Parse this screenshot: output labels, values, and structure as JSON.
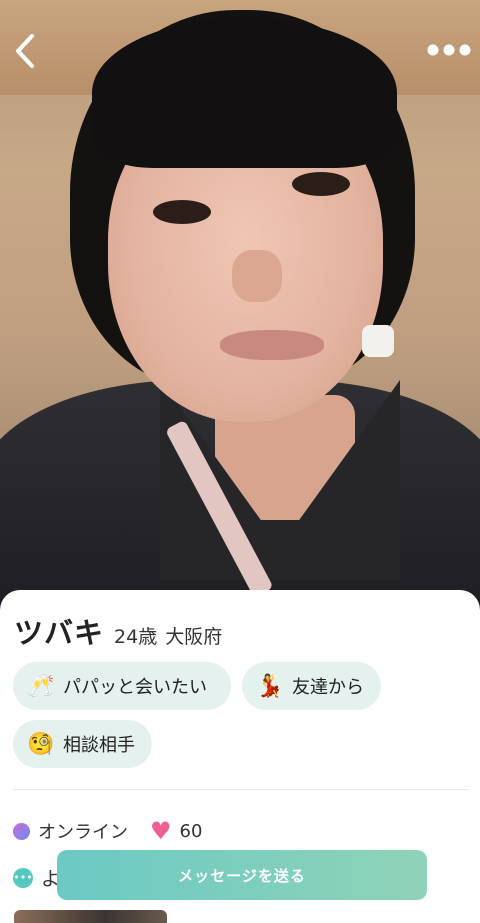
{
  "header": {
    "back_icon": "chevron-left-icon",
    "more_icon": "more-horizontal-icon"
  },
  "profile": {
    "name": "ツバキ",
    "age": "24歳",
    "location": "大阪府"
  },
  "tags": [
    {
      "icon": "🥂",
      "icon_name": "champagne-glasses-icon",
      "label": "パパッと会いたい"
    },
    {
      "icon": "💃",
      "icon_name": "dancer-icon",
      "label": "友達から"
    },
    {
      "icon": "🧐",
      "icon_name": "monocle-face-icon",
      "label": "相談相手"
    }
  ],
  "status": {
    "online_label": "オンライン",
    "likes_count": "60"
  },
  "hint": {
    "text": "よ"
  },
  "actions": {
    "send_message_label": "メッセージを送る"
  },
  "colors": {
    "chip_bg": "#e5f1ef",
    "button_gradient_start": "#6bc9c4",
    "button_gradient_end": "#8fd3b7",
    "heart": "#ef5f95"
  }
}
